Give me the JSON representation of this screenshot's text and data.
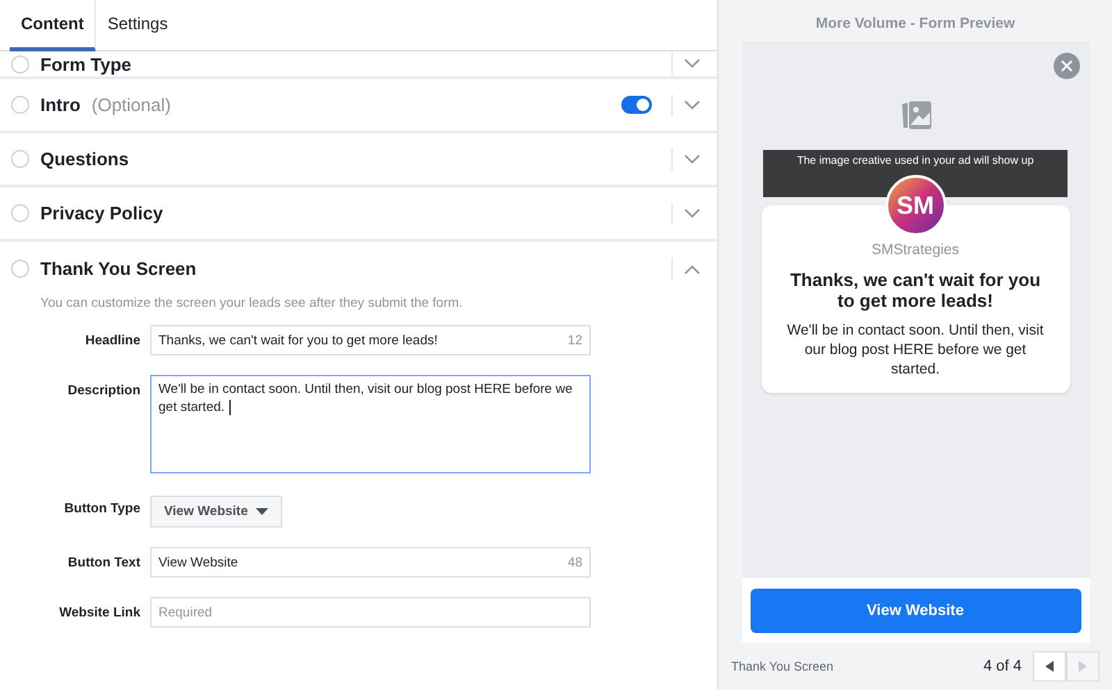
{
  "tabs": [
    {
      "label": "Content",
      "selected": true
    },
    {
      "label": "Settings",
      "selected": false
    }
  ],
  "sections": [
    {
      "title": "Form Type",
      "checked": false,
      "expanded": false
    },
    {
      "title": "Intro",
      "note": "(Optional)",
      "checked": false,
      "toggle": {
        "on": true
      },
      "expanded": false
    },
    {
      "title": "Questions",
      "checked": false,
      "expanded": false
    },
    {
      "title": "Privacy Policy",
      "checked": false,
      "expanded": false
    },
    {
      "title": "Thank You Screen",
      "checked": false,
      "expanded": true,
      "hint": "You can customize the screen your leads see after they submit the form.",
      "fields": [
        {
          "kind": "text",
          "label": "Headline",
          "value": "Thanks, we can't wait for you to get more leads!",
          "count": "12"
        },
        {
          "kind": "textarea",
          "label": "Description",
          "value": "We'll be in contact soon. Until then, visit our blog post HERE before we get started.",
          "focused": true
        },
        {
          "kind": "select",
          "label": "Button Type",
          "value": "View Website"
        },
        {
          "kind": "text",
          "label": "Button Text",
          "value": "View Website",
          "count": "48"
        },
        {
          "kind": "text",
          "label": "Website Link",
          "placeholder": "Required"
        }
      ]
    }
  ],
  "preview": {
    "title": "More Volume - Form Preview",
    "image_note": "The image creative used in your ad will show up",
    "logo_text": "SM",
    "brand": "SMStrategies",
    "headline": "Thanks, we can't wait for you to get more leads!",
    "description": "We'll be in contact soon. Until then, visit our blog post HERE before we get started.",
    "button": "View Website",
    "screen_label": "Thank You Screen",
    "pager": "4 of 4",
    "prev_disabled": false,
    "next_disabled": true
  }
}
